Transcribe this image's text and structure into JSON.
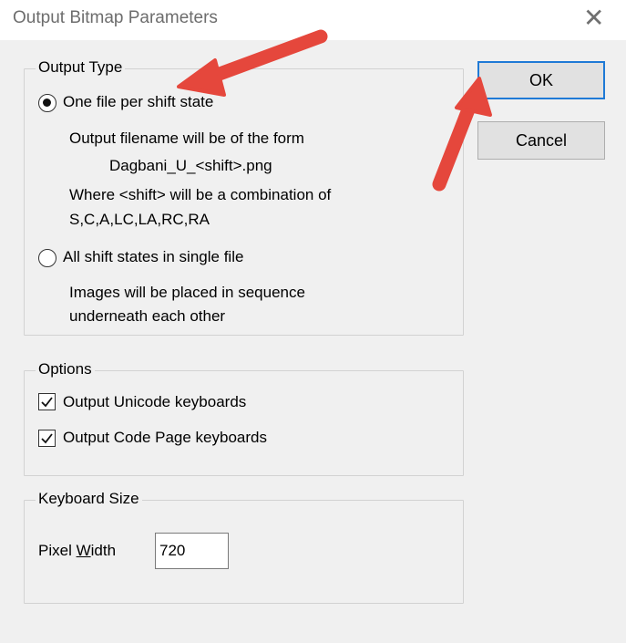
{
  "window": {
    "title": "Output Bitmap Parameters",
    "close_glyph": "✕"
  },
  "output_type": {
    "legend": "Output Type",
    "one_file": {
      "label": "One file per shift state",
      "selected": true,
      "desc_line1": "Output filename will be of the form",
      "desc_line2": "Dagbani_U_<shift>.png",
      "desc_line3": "Where <shift> will be a combination of",
      "desc_line4": "S,C,A,LC,LA,RC,RA"
    },
    "single_file": {
      "label": "All shift states in single file",
      "selected": false,
      "desc_line1": "Images will be placed in sequence",
      "desc_line2": "underneath each other"
    }
  },
  "options": {
    "legend": "Options",
    "unicode": {
      "label": "Output Unicode keyboards",
      "checked": true
    },
    "codepage": {
      "label": "Output Code Page keyboards",
      "checked": true
    }
  },
  "keyboard_size": {
    "legend": "Keyboard Size",
    "pixel_width_label_pre": "Pixel ",
    "pixel_width_label_u": "W",
    "pixel_width_label_post": "idth",
    "pixel_width_value": "720"
  },
  "buttons": {
    "ok": "OK",
    "cancel": "Cancel"
  },
  "colors": {
    "accent": "#1f7ad6",
    "annotation_arrow": "#e5473c"
  },
  "annotations": {
    "arrow_icon_1": "arrow-to-radio-icon",
    "arrow_icon_2": "arrow-to-ok-icon"
  }
}
